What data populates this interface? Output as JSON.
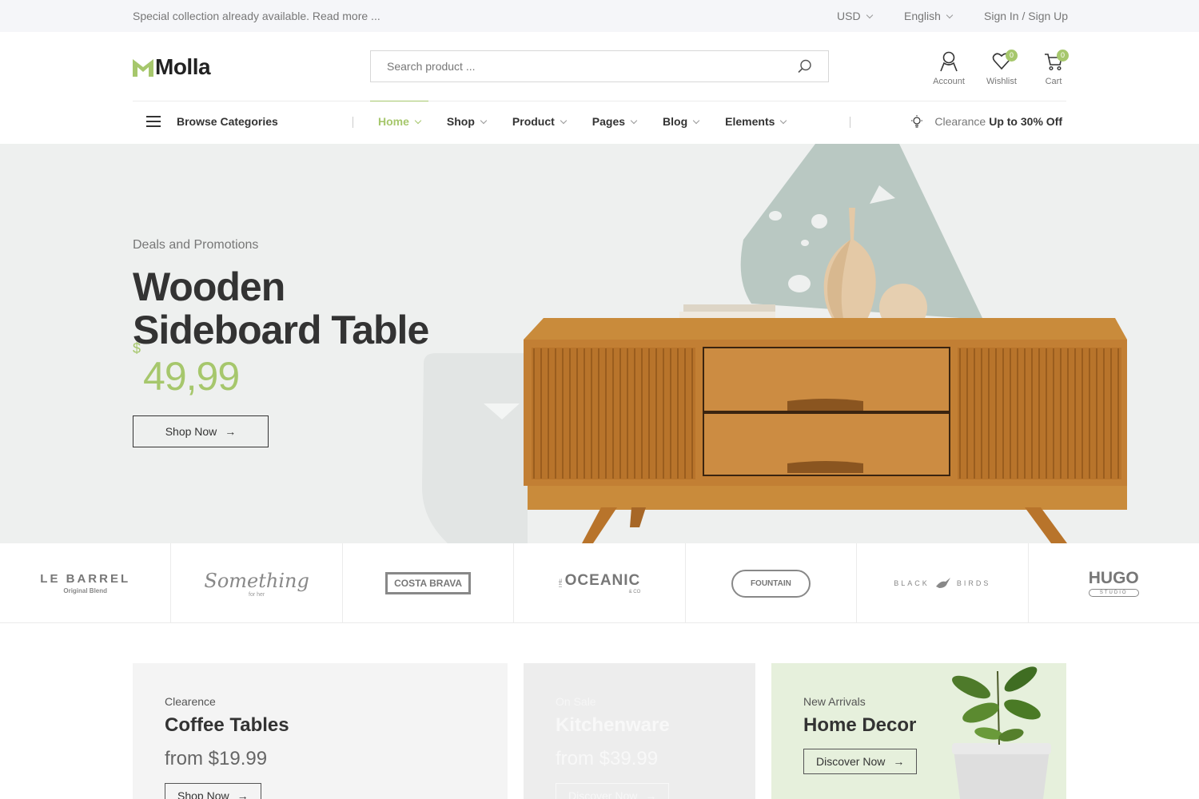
{
  "topbar": {
    "promo": "Special collection already available. Read more ...",
    "currency": "USD",
    "language": "English",
    "auth": "Sign In / Sign Up"
  },
  "header": {
    "logo": "Molla",
    "search_placeholder": "Search product ...",
    "account_label": "Account",
    "wishlist_label": "Wishlist",
    "wishlist_count": "0",
    "cart_label": "Cart",
    "cart_count": "0"
  },
  "nav": {
    "browse": "Browse Categories",
    "items": [
      {
        "label": "Home"
      },
      {
        "label": "Shop"
      },
      {
        "label": "Product"
      },
      {
        "label": "Pages"
      },
      {
        "label": "Blog"
      },
      {
        "label": "Elements"
      }
    ],
    "clearance_prefix": "Clearance",
    "clearance_offer": "Up to 30% Off"
  },
  "hero": {
    "subtitle": "Deals and Promotions",
    "title_line1": "Wooden",
    "title_line2": "Sideboard Table",
    "currency": "$",
    "price": "49,99",
    "button": "Shop Now"
  },
  "brands": [
    {
      "line1": "LE BARREL",
      "line2": "Original Blend"
    },
    {
      "line1": "Something",
      "line2": "for her"
    },
    {
      "line1": "COSTA BRAVA"
    },
    {
      "line1": "OCEANIC",
      "pre": "THE",
      "post": "& CO"
    },
    {
      "line1": "FOUNTAIN"
    },
    {
      "line1": "BLACK",
      "line2": "BIRDS"
    },
    {
      "line1": "HUGO",
      "line2": "STUDIO"
    }
  ],
  "banners": [
    {
      "category": "Clearence",
      "title": "Coffee Tables",
      "price": "from $19.99",
      "button": "Shop Now"
    },
    {
      "category": "On Sale",
      "title": "Kitchenware",
      "price": "from $39.99",
      "button": "Discover Now"
    },
    {
      "category": "New Arrivals",
      "title": "Home Decor",
      "button": "Discover Now"
    }
  ],
  "colors": {
    "accent": "#a6c76c",
    "hero_bg": "#eef0ef",
    "text_dark": "#333333"
  }
}
